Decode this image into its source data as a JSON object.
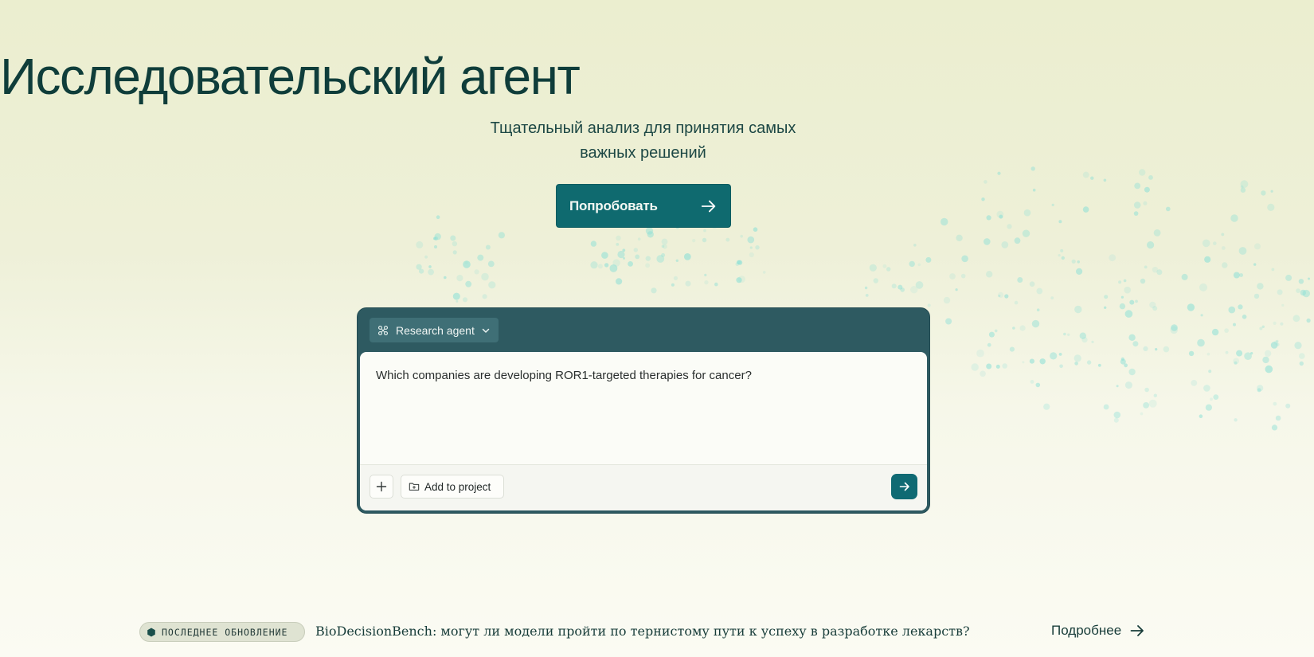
{
  "hero": {
    "title": "Исследовательский агент",
    "subtitle": "Тщательный анализ для принятия самых важных решений",
    "cta_label": "Попробовать"
  },
  "composer": {
    "agent_label": "Research agent",
    "prompt_text": "Which companies are developing ROR1-targeted therapies for cancer?",
    "add_to_project_label": "Add to project",
    "icons": {
      "agent": "network-nodes-icon",
      "agent_dropdown": "chevron-down-icon",
      "add": "plus-icon",
      "project": "folder-icon",
      "send": "arrow-right-icon"
    }
  },
  "banner": {
    "badge_label": "ПОСЛЕДНЕЕ ОБНОВЛЕНИЕ",
    "news_text": "BioDecisionBench: могут ли модели пройти по тернистому пути к успеху в разработке лекарств?",
    "more_label": "Подробнее"
  },
  "colors": {
    "background_top": "#ebeecf",
    "background_bottom": "#fbfbf3",
    "primary": "#0f6a6f",
    "card": "#2e5a61",
    "text": "#0f3d3a",
    "dots": "#8ee0d6"
  }
}
